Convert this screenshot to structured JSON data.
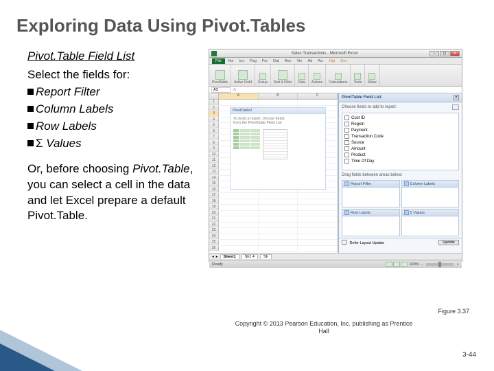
{
  "slide": {
    "title": "Exploring Data Using Pivot.Tables",
    "subhead": "Pivot.Table Field List",
    "select_line": "Select the fields for:",
    "fields": [
      "Report Filter",
      "Column Labels",
      "Row Labels",
      "S Values"
    ],
    "sigma_prefix": "Σ",
    "para2a": "Or, before choosing ",
    "para2b": "Pivot.Table",
    "para2c": ", you can select a cell in the data and let Excel prepare a default Pivot.Table.",
    "figure_label": "Figure 3.37",
    "copyright": "Copyright © 2013 Pearson Education, Inc. publishing as Prentice Hall",
    "page_num": "3-44"
  },
  "excel": {
    "title": "Sales Transactions - Microsoft Excel",
    "tabs": [
      "Hor",
      "Ins",
      "Pag",
      "For",
      "Dat",
      "Rev",
      "Vie",
      "Ad",
      "Acr"
    ],
    "context_tabs": [
      "Opt",
      "Des"
    ],
    "ribbon_groups": [
      "PivotTable",
      "Active Field",
      "Group",
      "Sort & Filter",
      "Data",
      "Actions",
      "Calculations",
      "Tools",
      "Show"
    ],
    "name_box": "A3",
    "columns": [
      "A",
      "B",
      "C"
    ],
    "rows_count": 26,
    "selected_row": 3,
    "pivot_placeholder": {
      "title": "PivotTable2",
      "text1": "To build a report, choose fields",
      "text2": "from the PivotTable Field List"
    },
    "field_list": {
      "title": "PivotTable Field List",
      "subtitle": "Choose fields to add to report:",
      "fields": [
        "Cust ID",
        "Region",
        "Payment",
        "Transaction Code",
        "Source",
        "Amount",
        "Product",
        "Time Of Day"
      ],
      "drag_text": "Drag fields between areas below:",
      "zones": [
        "Report Filter",
        "Column Labels",
        "Row Labels",
        "Σ Values"
      ],
      "defer": "Defer Layout Update",
      "update": "Update"
    },
    "sheet_tabs": [
      "Sheet1",
      "Sh1 4",
      "Sh"
    ],
    "status": "Ready",
    "zoom": "100%"
  }
}
